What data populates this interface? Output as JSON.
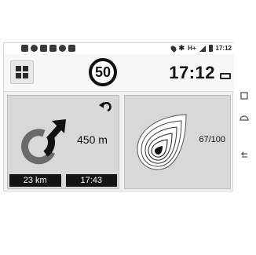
{
  "status_bar": {
    "icons_left": [
      "sim-icon",
      "sync-icon",
      "alert-icon",
      "mail-icon",
      "record-icon",
      "camera-icon"
    ],
    "network": "H+",
    "time": "17:12"
  },
  "header": {
    "speed_limit": "50",
    "time": "17:12"
  },
  "navigation": {
    "distance": "450 m",
    "trip_distance": "23 km",
    "arrival_time": "17:43"
  },
  "eco": {
    "score": "67/100"
  },
  "colors": {
    "card": "#d8d8d8",
    "screen": "#f2f2f2",
    "dark": "#141414"
  }
}
